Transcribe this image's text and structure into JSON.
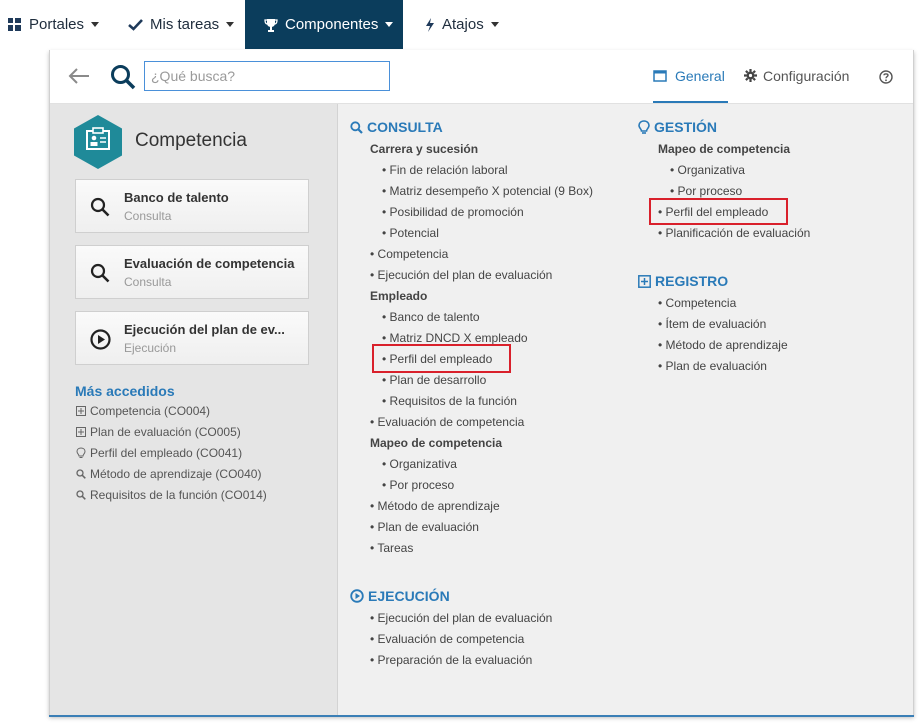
{
  "topnav": {
    "items": [
      {
        "label": "Portales",
        "icon": "grid-icon"
      },
      {
        "label": "Mis tareas",
        "icon": "check-icon"
      },
      {
        "label": "Componentes",
        "icon": "trophy-icon",
        "active": true
      },
      {
        "label": "Atajos",
        "icon": "bolt-icon"
      }
    ]
  },
  "toolbar": {
    "search_placeholder": "¿Qué busca?",
    "tabs": [
      {
        "label": "General",
        "active": true
      },
      {
        "label": "Configuración"
      }
    ]
  },
  "component": {
    "title": "Competencia",
    "cards": [
      {
        "title": "Banco de talento",
        "subtitle": "Consulta",
        "icon": "search-icon"
      },
      {
        "title": "Evaluación de competencia",
        "subtitle": "Consulta",
        "icon": "search-icon"
      },
      {
        "title": "Ejecución del plan de ev...",
        "subtitle": "Ejecución",
        "icon": "play-circle-icon"
      }
    ],
    "most_accessed_title": "Más accedidos",
    "most_accessed": [
      {
        "label": "Competencia (CO004)",
        "icon": "plus-square-icon"
      },
      {
        "label": "Plan de evaluación (CO005)",
        "icon": "plus-square-icon"
      },
      {
        "label": "Perfil del empleado (CO041)",
        "icon": "lightbulb-icon"
      },
      {
        "label": "Método de aprendizaje (CO040)",
        "icon": "search-icon"
      },
      {
        "label": "Requisitos de la función (CO014)",
        "icon": "search-icon"
      }
    ]
  },
  "consulta": {
    "title": "CONSULTA",
    "g1": "Carrera y sucesión",
    "g1_items": [
      "• Fin de relación laboral",
      "• Matriz desempeño X potencial (9 Box)",
      "• Posibilidad de promoción",
      "• Potencial"
    ],
    "items_a": [
      "• Competencia",
      "• Ejecución del plan de evaluación"
    ],
    "g2": "Empleado",
    "g2_items": [
      "• Banco de talento",
      "• Matriz DNCD X empleado",
      "• Perfil del empleado",
      "• Plan de desarrollo",
      "• Requisitos de la función"
    ],
    "item_b": "• Evaluación de competencia",
    "g3": "Mapeo de competencia",
    "g3_items": [
      "• Organizativa",
      "• Por proceso"
    ],
    "items_c": [
      "• Método de aprendizaje",
      "• Plan de evaluación",
      "• Tareas"
    ]
  },
  "ejecucion": {
    "title": "EJECUCIÓN",
    "items": [
      "• Ejecución del plan de evaluación",
      "• Evaluación de competencia",
      "• Preparación de la evaluación"
    ]
  },
  "gestion": {
    "title": "GESTIÓN",
    "g1": "Mapeo de competencia",
    "g1_items": [
      "• Organizativa",
      "• Por proceso"
    ],
    "items": [
      "• Perfil del empleado",
      "• Planificación de evaluación"
    ]
  },
  "registro": {
    "title": "REGISTRO",
    "items": [
      "• Competencia",
      "• Ítem de evaluación",
      "• Método de aprendizaje",
      "• Plan de evaluación"
    ]
  },
  "colors": {
    "accent": "#2a7ab8",
    "nav_active": "#0b3d5c",
    "highlight": "#d9202b",
    "icon_teal": "#1f8a99"
  }
}
